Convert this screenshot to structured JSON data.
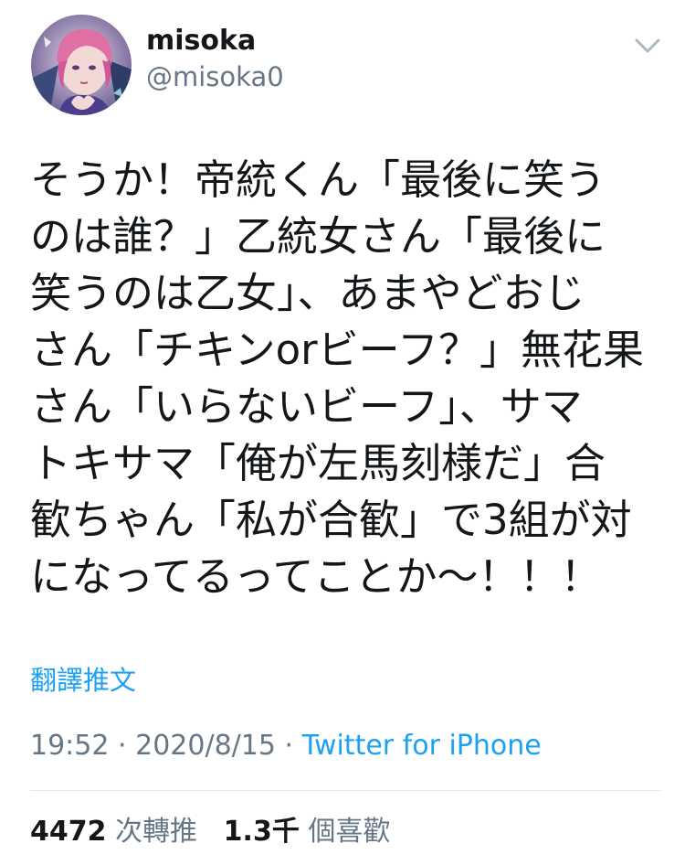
{
  "user": {
    "display_name": "misoka",
    "handle": "@misoka0"
  },
  "icons": {
    "menu": "chevron-down-icon",
    "avatar": "avatar-image"
  },
  "tweet": {
    "lines": [
      "そうか！帝統くん「最後に笑う",
      "のは誰？」乙統女さん「最後に",
      "笑うのは乙女」、あまやどおじ",
      "さん「チキンorビーフ？」無花果",
      "さん「いらないビーフ」、サマ",
      "トキサマ「俺が左馬刻様だ」合",
      "歓ちゃん「私が合歓」で3組が対",
      "になってるってことか〜！！！"
    ],
    "translate_label": "翻譯推文"
  },
  "meta": {
    "time": "19:52",
    "separator": "·",
    "date": "2020/8/15",
    "source": "Twitter for iPhone"
  },
  "stats": {
    "retweets_count": "4472",
    "retweets_label": "次轉推",
    "likes_count": "1.3千",
    "likes_label": "個喜歡"
  },
  "colors": {
    "link": "#1da1f2",
    "secondary": "#657786",
    "primary": "#14171a",
    "divider": "#e1e8ed"
  }
}
